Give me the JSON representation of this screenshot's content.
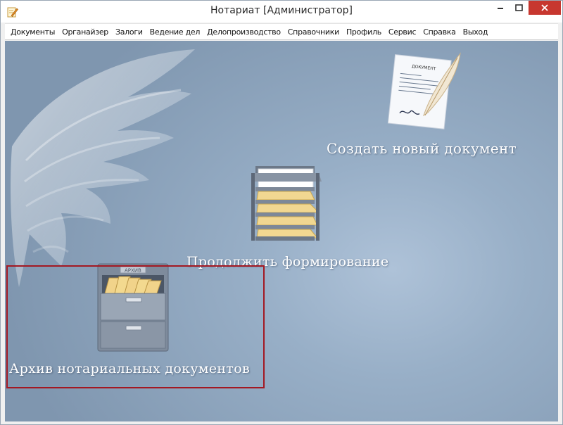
{
  "window": {
    "title": "Нотариат [Администратор]"
  },
  "menu": {
    "items": [
      {
        "label": "Документы"
      },
      {
        "label": "Органайзер"
      },
      {
        "label": "Залоги"
      },
      {
        "label": "Ведение дел"
      },
      {
        "label": "Делопроизводство"
      },
      {
        "label": "Справочники"
      },
      {
        "label": "Профиль"
      },
      {
        "label": "Сервис"
      },
      {
        "label": "Справка"
      },
      {
        "label": "Выход"
      }
    ]
  },
  "actions": {
    "create": {
      "label": "Создать новый документ",
      "icon": "document-quill-icon"
    },
    "continue": {
      "label": "Продолжить формирование",
      "icon": "document-trays-icon"
    },
    "archive": {
      "label": "Архив нотариальных документов",
      "icon": "file-cabinet-icon",
      "cabinet_tag": "АРХИВ"
    }
  },
  "document_icon": {
    "heading": "ДОКУМЕНТ"
  },
  "colors": {
    "selection_border": "#a31822",
    "close_button": "#c7372f",
    "label_text": "#ffffff"
  }
}
